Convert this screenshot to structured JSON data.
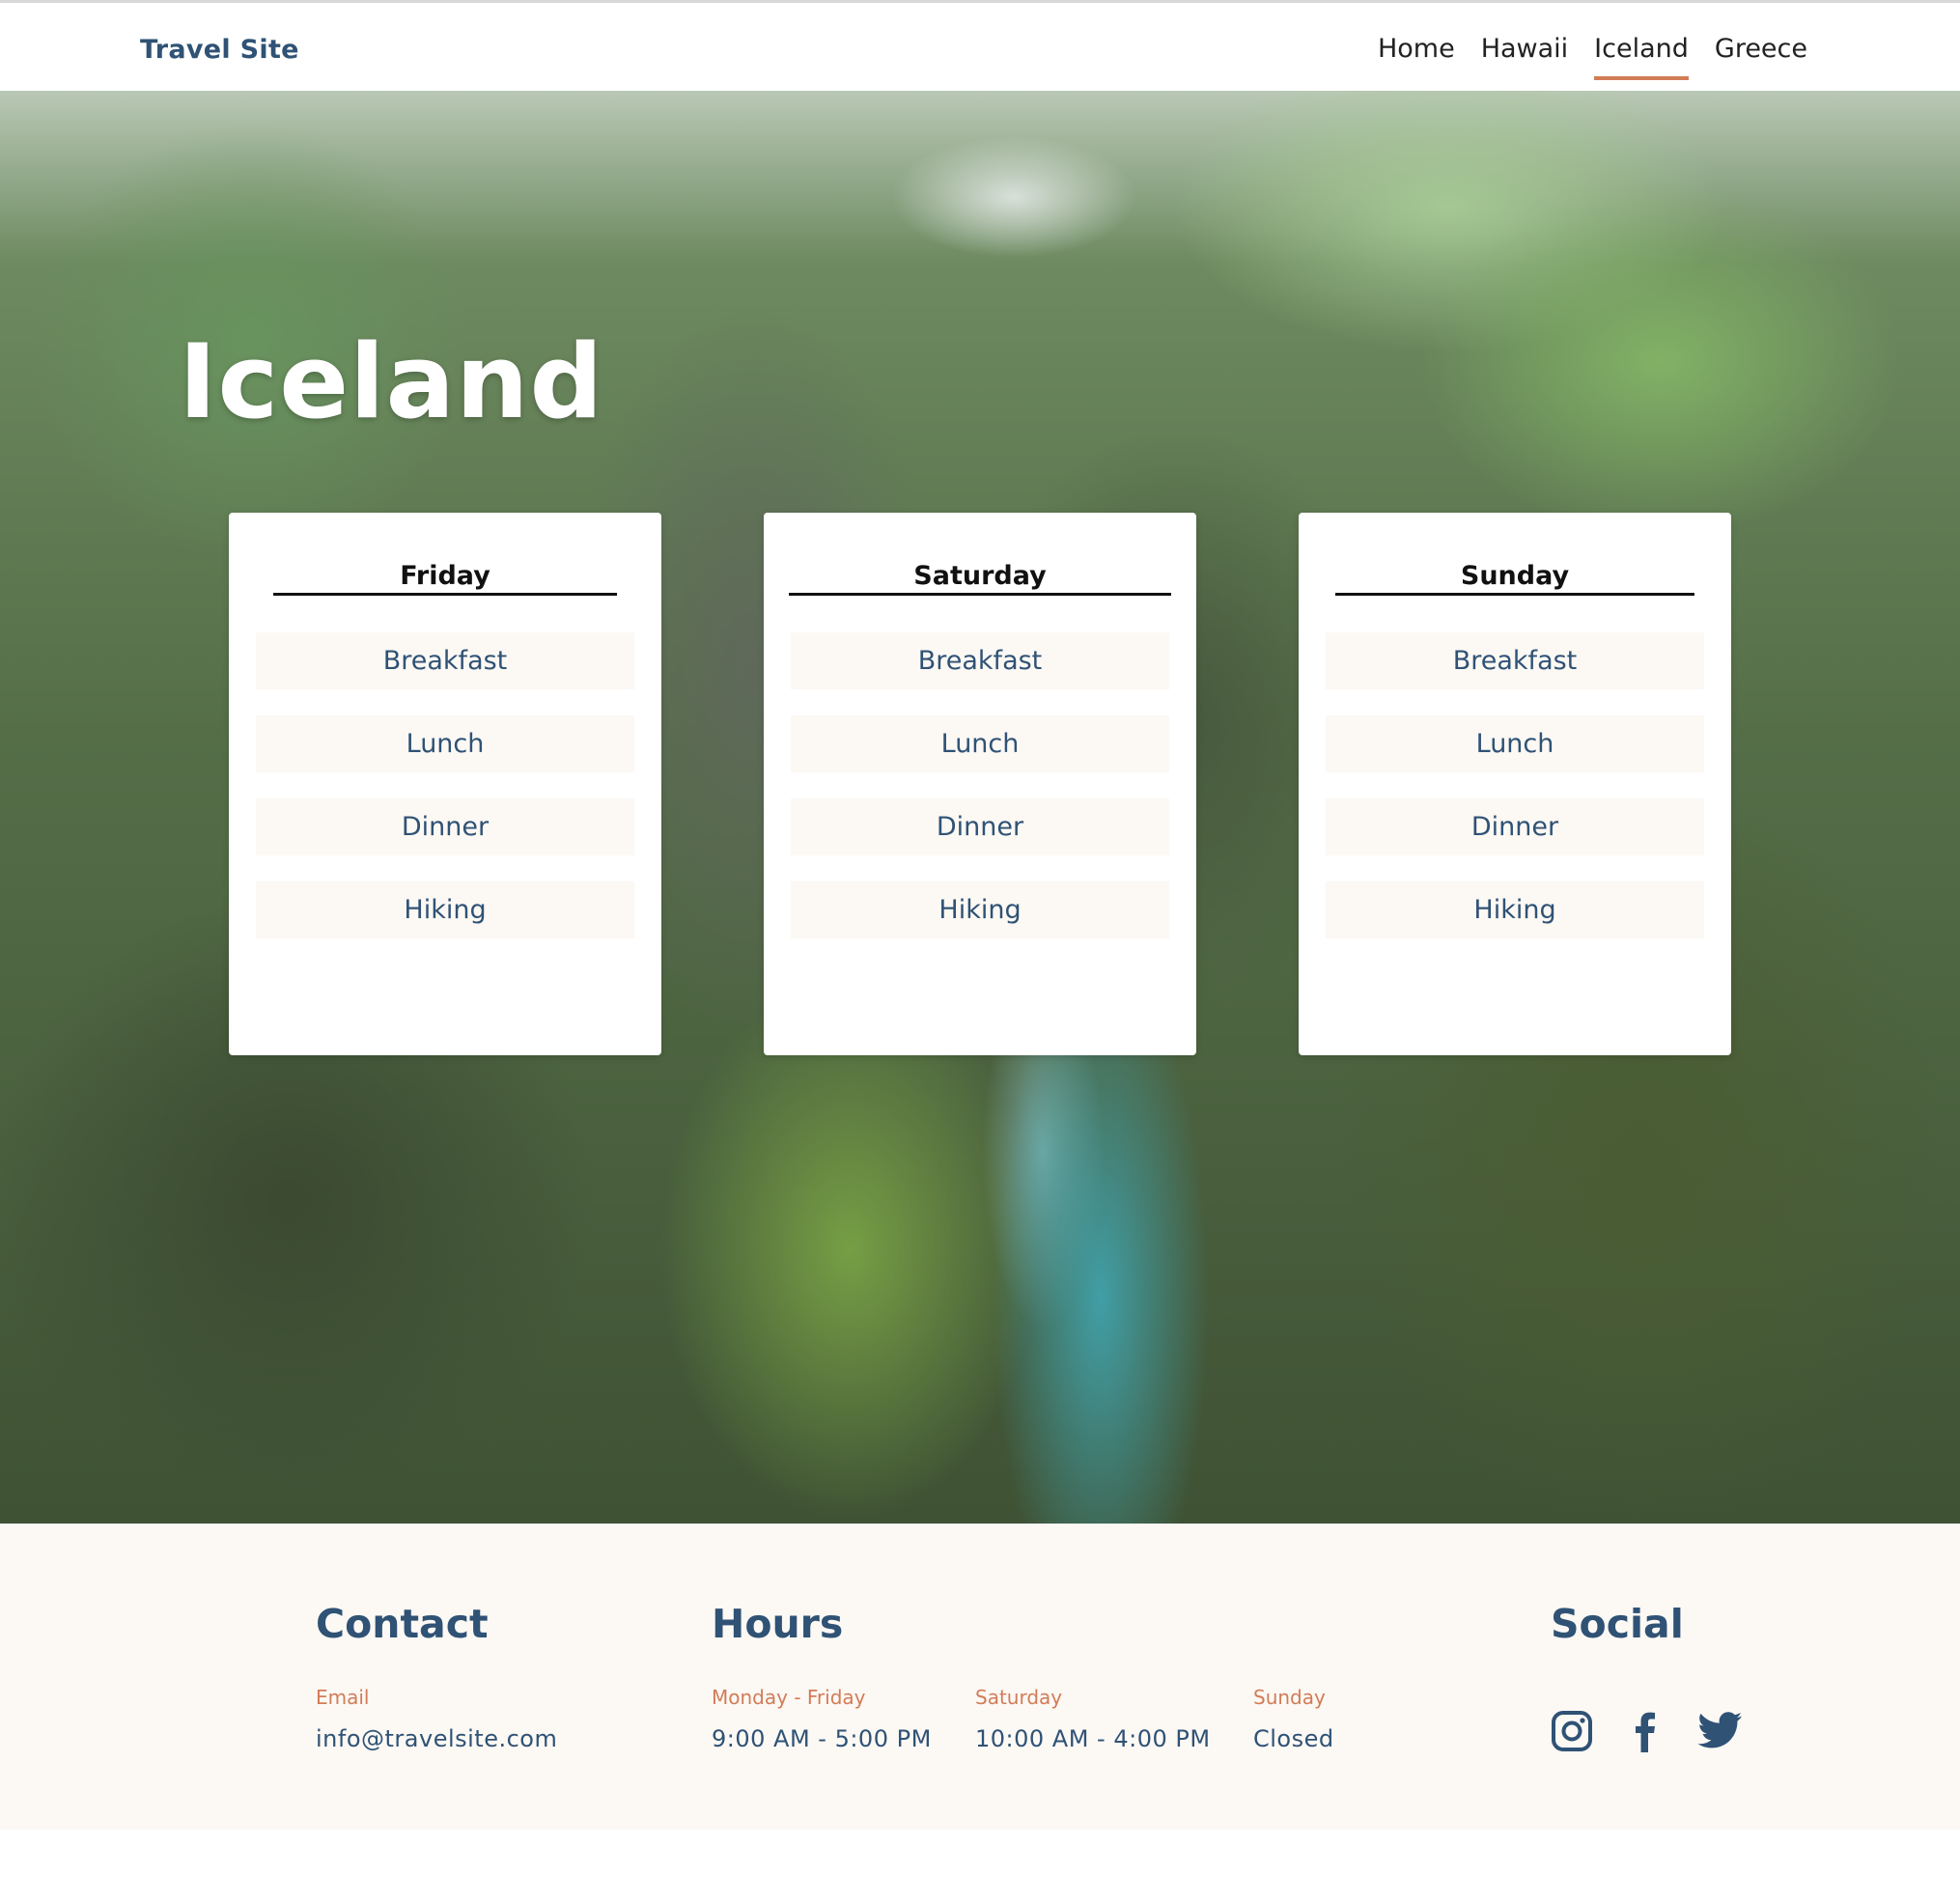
{
  "header": {
    "logo": "Travel Site",
    "nav": [
      "Home",
      "Hawaii",
      "Iceland",
      "Greece"
    ],
    "active_nav": "Iceland"
  },
  "hero": {
    "title": "Iceland",
    "days": [
      {
        "name": "Friday",
        "items": [
          "Breakfast",
          "Lunch",
          "Dinner",
          "Hiking"
        ]
      },
      {
        "name": "Saturday",
        "items": [
          "Breakfast",
          "Lunch",
          "Dinner",
          "Hiking"
        ]
      },
      {
        "name": "Sunday",
        "items": [
          "Breakfast",
          "Lunch",
          "Dinner",
          "Hiking"
        ]
      }
    ]
  },
  "footer": {
    "contact": {
      "heading": "Contact",
      "email_label": "Email",
      "email": "info@travelsite.com"
    },
    "hours": {
      "heading": "Hours",
      "entries": [
        {
          "label": "Monday - Friday",
          "value": "9:00 AM - 5:00 PM"
        },
        {
          "label": "Saturday",
          "value": "10:00 AM - 4:00 PM"
        },
        {
          "label": "Sunday",
          "value": "Closed"
        }
      ]
    },
    "social": {
      "heading": "Social",
      "icons": [
        "instagram-icon",
        "facebook-icon",
        "twitter-icon"
      ]
    }
  },
  "colors": {
    "brand": "#2f5275",
    "accent": "#d27c57",
    "footer_bg": "#fcf8f4"
  }
}
